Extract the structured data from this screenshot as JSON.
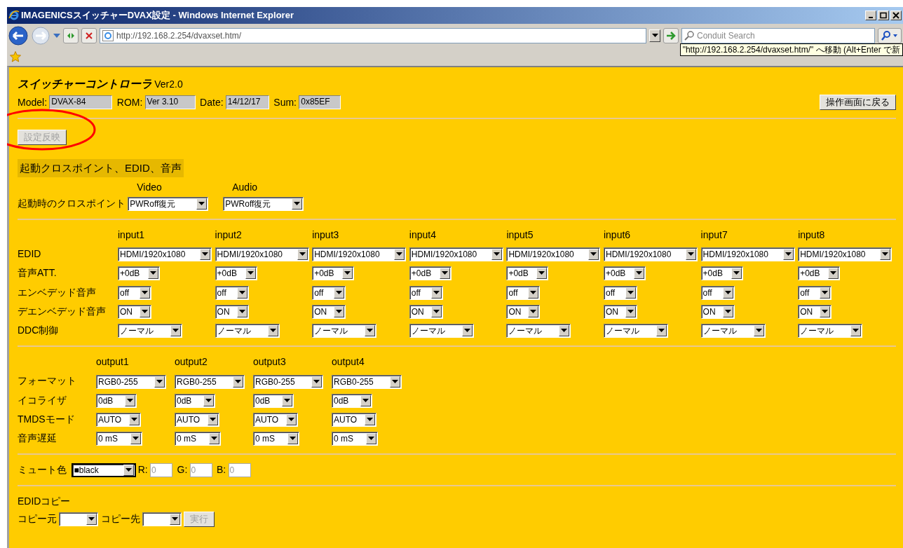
{
  "window": {
    "title": "IMAGENICSスイッチャーDVAX設定 - Windows Internet Explorer"
  },
  "address_bar": {
    "url": "http://192.168.2.254/dvaxset.htm/"
  },
  "search": {
    "placeholder": "Conduit Search"
  },
  "tooltip": {
    "text": "\"http://192.168.2.254/dvaxset.htm/\" へ移動 (Alt+Enter で新"
  },
  "page": {
    "title": "スイッチャーコントローラ",
    "version": "Ver2.0",
    "info": [
      {
        "label": "Model:",
        "value": "DVAX-84"
      },
      {
        "label": "ROM:",
        "value": "Ver 3.10"
      },
      {
        "label": "Date:",
        "value": "14/12/17"
      },
      {
        "label": "Sum:",
        "value": "0x85EF"
      }
    ],
    "back_button": "操作画面に戻る",
    "apply_button": {
      "label": "設定反映",
      "disabled": true
    },
    "annotation": {
      "kind": "ellipse",
      "color": "#ff0000"
    },
    "startup": {
      "heading": "起動クロスポイント、EDID、音声",
      "row_label": "起動時のクロスポイント",
      "fields": [
        {
          "label": "Video",
          "value": "PWRoff復元"
        },
        {
          "label": "Audio",
          "value": "PWRoff復元"
        }
      ]
    },
    "inputs": {
      "row_labels": [
        "EDID",
        "音声ATT.",
        "エンベデッド音声",
        "デエンベデッド音声",
        "DDC制御"
      ],
      "columns": [
        {
          "name": "input1",
          "values": [
            "HDMI/1920x1080",
            "+0dB",
            "off",
            "ON",
            "ノーマル"
          ]
        },
        {
          "name": "input2",
          "values": [
            "HDMI/1920x1080",
            "+0dB",
            "off",
            "ON",
            "ノーマル"
          ]
        },
        {
          "name": "input3",
          "values": [
            "HDMI/1920x1080",
            "+0dB",
            "off",
            "ON",
            "ノーマル"
          ]
        },
        {
          "name": "input4",
          "values": [
            "HDMI/1920x1080",
            "+0dB",
            "off",
            "ON",
            "ノーマル"
          ]
        },
        {
          "name": "input5",
          "values": [
            "HDMI/1920x1080",
            "+0dB",
            "off",
            "ON",
            "ノーマル"
          ]
        },
        {
          "name": "input6",
          "values": [
            "HDMI/1920x1080",
            "+0dB",
            "off",
            "ON",
            "ノーマル"
          ]
        },
        {
          "name": "input7",
          "values": [
            "HDMI/1920x1080",
            "+0dB",
            "off",
            "ON",
            "ノーマル"
          ]
        },
        {
          "name": "input8",
          "values": [
            "HDMI/1920x1080",
            "+0dB",
            "off",
            "ON",
            "ノーマル"
          ]
        }
      ]
    },
    "outputs": {
      "row_labels": [
        "フォーマット",
        "イコライザ",
        "TMDSモード",
        "音声遅延"
      ],
      "columns": [
        {
          "name": "output1",
          "values": [
            "RGB0-255",
            "0dB",
            "AUTO",
            "0 mS"
          ]
        },
        {
          "name": "output2",
          "values": [
            "RGB0-255",
            "0dB",
            "AUTO",
            "0 mS"
          ]
        },
        {
          "name": "output3",
          "values": [
            "RGB0-255",
            "0dB",
            "AUTO",
            "0 mS"
          ]
        },
        {
          "name": "output4",
          "values": [
            "RGB0-255",
            "0dB",
            "AUTO",
            "0 mS"
          ]
        }
      ]
    },
    "mute": {
      "label": "ミュート色",
      "value": "■black",
      "rgb": [
        {
          "label": "R:",
          "value": "0",
          "disabled": true
        },
        {
          "label": "G:",
          "value": "0",
          "disabled": true
        },
        {
          "label": "B:",
          "value": "0",
          "disabled": true
        }
      ]
    },
    "edid_copy": {
      "heading": "EDIDコピー",
      "source_label": "コピー元",
      "dest_label": "コピー先",
      "button": {
        "label": "実行",
        "disabled": true
      }
    }
  }
}
